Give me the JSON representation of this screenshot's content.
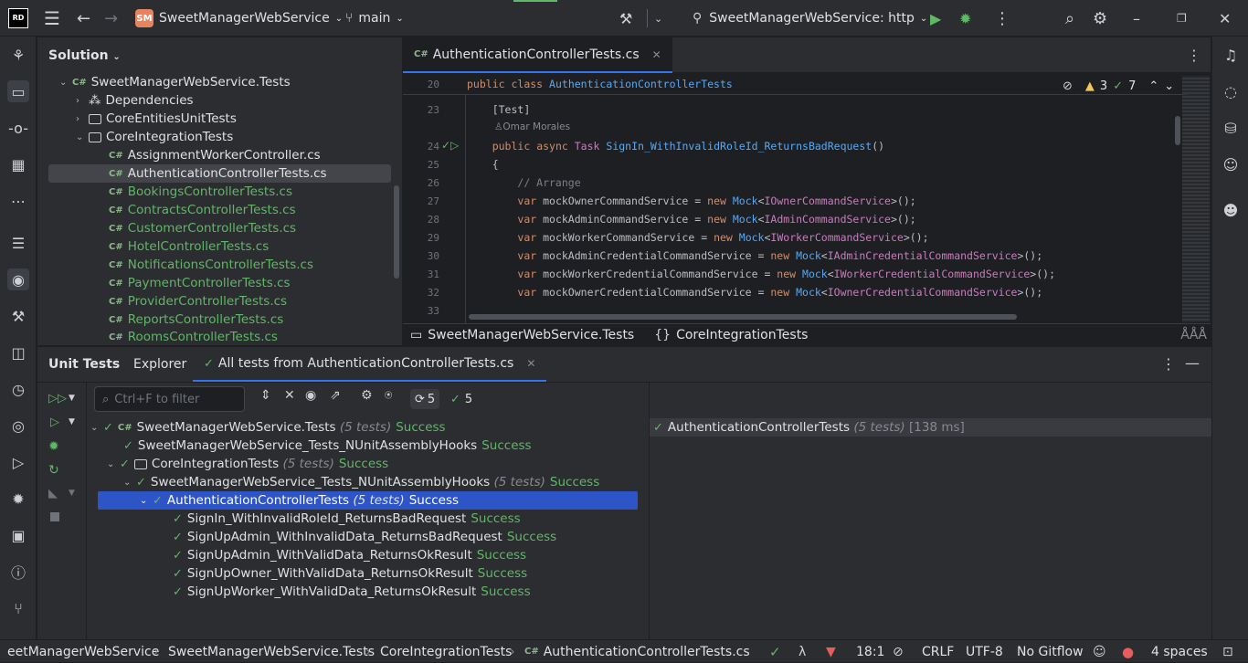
{
  "titlebar": {
    "logo": "RD",
    "project_initials": "SM",
    "project": "SweetManagerWebService",
    "branch": "main",
    "run_config": "SweetManagerWebService: http"
  },
  "solution": {
    "title": "Solution",
    "items": [
      {
        "label": "SweetManagerWebService.Tests"
      },
      {
        "label": "Dependencies"
      },
      {
        "label": "CoreEntitiesUnitTests"
      },
      {
        "label": "CoreIntegrationTests"
      },
      {
        "label": "AssignmentWorkerController.cs"
      },
      {
        "label": "AuthenticationControllerTests.cs"
      },
      {
        "label": "BookingsControllerTests.cs"
      },
      {
        "label": "ContractsControllerTests.cs"
      },
      {
        "label": "CustomerControllerTests.cs"
      },
      {
        "label": "HotelControllerTests.cs"
      },
      {
        "label": "NotificationsControllerTests.cs"
      },
      {
        "label": "PaymentControllerTests.cs"
      },
      {
        "label": "ProviderControllerTests.cs"
      },
      {
        "label": "ReportsControllerTests.cs"
      },
      {
        "label": "RoomsControllerTests.cs"
      }
    ],
    "cs_badge": "C#"
  },
  "editor": {
    "tab": "AuthenticationControllerTests.cs",
    "warnings": "3",
    "checks": "7",
    "author": "Omar Morales",
    "lines": {
      "l20": "20",
      "l23": "23",
      "l24": "24",
      "l25": "25",
      "l26": "26",
      "l27": "27",
      "l28": "28",
      "l29": "29",
      "l30": "30",
      "l31": "31",
      "l32": "32",
      "l33": "33"
    },
    "code": {
      "public": "public",
      "class": "class",
      "async": "async",
      "new": "new",
      "var": "var",
      "classname": "AuthenticationControllerTests",
      "attr": "Test",
      "task": "Task",
      "method": "SignIn_WithInvalidRoleId_ReturnsBadRequest",
      "brace": "{",
      "comment": "// Arrange",
      "mock": "Mock",
      "v1": "mockOwnerCommandService",
      "t1": "IOwnerCommandService",
      "v2": "mockAdminCommandService",
      "t2": "IAdminCommandService",
      "v3": "mockWorkerCommandService",
      "t3": "IWorkerCommandService",
      "v4": "mockAdminCredentialCommandService",
      "t4": "IAdminCredentialCommandService",
      "v5": "mockWorkerCredentialCommandService",
      "t5": "IWorkerCredentialCommandService",
      "v6": "mockOwnerCredentialCommandService",
      "t6": "IOwnerCredentialCommandService"
    },
    "breadcrumb": [
      "SweetManagerWebService.Tests",
      "CoreIntegrationTests"
    ]
  },
  "tests": {
    "tabs": [
      "Unit Tests",
      "Explorer",
      "All tests from AuthenticationControllerTests.cs"
    ],
    "filter_placeholder": "Ctrl+F to filter",
    "count_a": "5",
    "count_b": "5",
    "tree": [
      {
        "name": "SweetManagerWebService.Tests",
        "meta": "(5 tests)",
        "status": "Success"
      },
      {
        "name": "SweetManagerWebService_Tests_NUnitAssemblyHooks",
        "meta": "",
        "status": "Success"
      },
      {
        "name": "CoreIntegrationTests",
        "meta": "(5 tests)",
        "status": "Success"
      },
      {
        "name": "SweetManagerWebService_Tests_NUnitAssemblyHooks",
        "meta": "(5 tests)",
        "status": "Success"
      },
      {
        "name": "AuthenticationControllerTests",
        "meta": "(5 tests)",
        "status": "Success"
      },
      {
        "name": "SignIn_WithInvalidRoleId_ReturnsBadRequest",
        "meta": "",
        "status": "Success"
      },
      {
        "name": "SignUpAdmin_WithInvalidData_ReturnsBadRequest",
        "meta": "",
        "status": "Success"
      },
      {
        "name": "SignUpAdmin_WithValidData_ReturnsOkResult",
        "meta": "",
        "status": "Success"
      },
      {
        "name": "SignUpOwner_WithValidData_ReturnsOkResult",
        "meta": "",
        "status": "Success"
      },
      {
        "name": "SignUpWorker_WithValidData_ReturnsOkResult",
        "meta": "",
        "status": "Success"
      }
    ],
    "result": {
      "name": "AuthenticationControllerTests",
      "meta": "(5 tests)",
      "time": "[138 ms]"
    }
  },
  "status": {
    "path": [
      "eetManagerWebService",
      "SweetManagerWebService.Tests",
      "CoreIntegrationTests",
      "AuthenticationControllerTests.cs"
    ],
    "position": "18:1",
    "line_sep": "CRLF",
    "encoding": "UTF-8",
    "gitflow": "No Gitflow",
    "indent": "4 spaces"
  }
}
